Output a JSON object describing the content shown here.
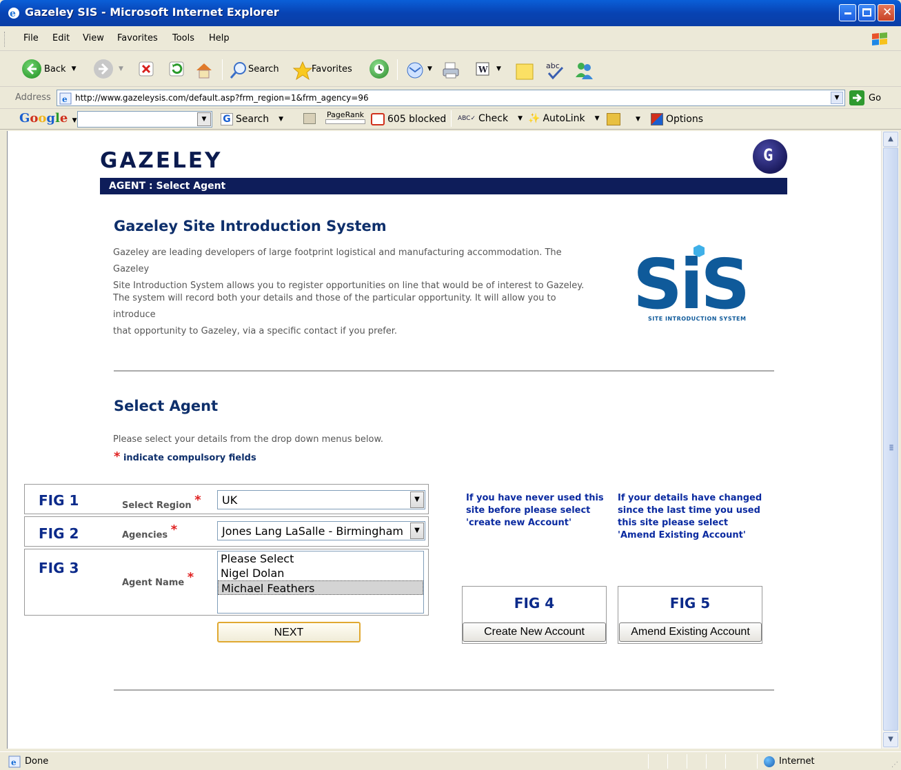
{
  "window": {
    "title": "Gazeley SIS - Microsoft Internet Explorer"
  },
  "menu": [
    "File",
    "Edit",
    "View",
    "Favorites",
    "Tools",
    "Help"
  ],
  "toolbar": {
    "back": "Back",
    "search": "Search",
    "favorites": "Favorites"
  },
  "address": {
    "label": "Address",
    "url": "http://www.gazeleysis.com/default.asp?frm_region=1&frm_agency=96",
    "go": "Go"
  },
  "google_toolbar": {
    "logo": "Google",
    "search": "Search",
    "pagerank": "PageRank",
    "blocked": "605 blocked",
    "check": "Check",
    "autolink": "AutoLink",
    "options": "Options"
  },
  "page": {
    "brand": "GAZELEY",
    "badge": "G",
    "nav_title": "AGENT : Select Agent",
    "heading": "Gazeley Site Introduction System",
    "intro_1_line1": "Gazeley are leading developers of large footprint logistical and manufacturing accommodation. The Gazeley",
    "intro_1_line2": "Site Introduction System allows you to register opportunities on line that would be of interest to Gazeley.",
    "intro_2_line1": "The system will record both your details and those of the particular opportunity. It will allow you to introduce",
    "intro_2_line2": "that opportunity to Gazeley, via a specific contact if you prefer.",
    "sis_logo": "SiS",
    "sis_subtitle": "SITE INTRODUCTION SYSTEM",
    "select_heading": "Select Agent",
    "instructions": "Please select your details from the drop down menus below.",
    "required_star": "*",
    "required_note": "indicate compulsory fields"
  },
  "form": {
    "fig1": {
      "label": "FIG 1",
      "field": "Select Region",
      "value": "UK"
    },
    "fig2": {
      "label": "FIG 2",
      "field": "Agencies",
      "value": "Jones Lang LaSalle - Birmingham"
    },
    "fig3": {
      "label": "FIG 3",
      "field": "Agent Name",
      "options": [
        "Please Select",
        "Nigel Dolan",
        "Michael Feathers"
      ],
      "selected": "Michael Feathers"
    },
    "next_button": "NEXT"
  },
  "accounts": {
    "new_note_1": "If you have never used this",
    "new_note_2": "site before please select",
    "new_note_3": "'create new Account'",
    "amend_note_1": "If your details have changed",
    "amend_note_2": "since the last time you used",
    "amend_note_3": "this site please select",
    "amend_note_4": "'Amend Existing Account'",
    "fig4": "FIG 4",
    "fig5": "FIG 5",
    "create_button": "Create New Account",
    "amend_button": "Amend Existing Account"
  },
  "status": {
    "left": "Done",
    "zone": "Internet"
  }
}
